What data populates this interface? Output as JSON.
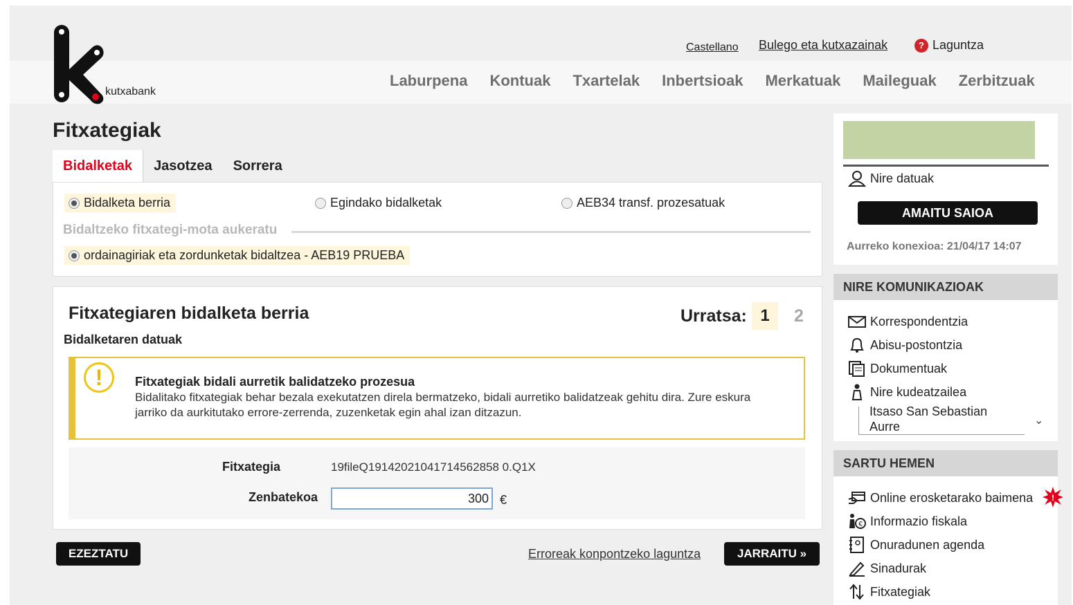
{
  "brand": {
    "name": "kutxabank"
  },
  "toplinks": {
    "language": "Castellano",
    "offices": "Bulego eta kutxazainak",
    "help": "Laguntza",
    "help_icon": "?"
  },
  "nav": {
    "items": [
      "Laburpena",
      "Kontuak",
      "Txartelak",
      "Inbertsioak",
      "Merkatuak",
      "Maileguak",
      "Zerbitzuak"
    ]
  },
  "page": {
    "title": "Fitxategiak"
  },
  "tabs": [
    "Bidalketak",
    "Jasotzea",
    "Sorrera"
  ],
  "options": {
    "radios": [
      "Bidalketa berria",
      "Egindako bidalketak",
      "AEB34 transf. prozesatuak"
    ],
    "legend": "Bidaltzeko fitxategi-mota aukeratu",
    "file_type": "ordainagiriak eta zordunketak bidaltzea - AEB19 PRUEBA"
  },
  "form": {
    "title": "Fitxategiaren bidalketa berria",
    "step_label": "Urratsa:",
    "step_current": "1",
    "step_next": "2",
    "subtitle": "Bidalketaren datuak",
    "alert_title": "Fitxategiak bidali aurretik balidatzeko prozesua",
    "alert_text": "Bidalitako fitxategiak behar bezala exekutatzen direla bermatzeko, bidali aurretiko balidatzeak gehitu dira. Zure eskura jarriko da aurkitutako errore-zerrenda, zuzenketak egin ahal izan ditzazun.",
    "file_label": "Fitxategia",
    "file_value": "19fileQ19142021041714562858 0.Q1X",
    "amount_label": "Zenbatekoa",
    "amount_value": "300",
    "currency": "€"
  },
  "actions": {
    "cancel": "EZEZTATU",
    "help_link": "Erroreak konpontzeko laguntza",
    "continue": "JARRAITU »"
  },
  "sidebar": {
    "my_data": "Nire datuak",
    "logout": "AMAITU SAIOA",
    "last_connection": "Aurreko konexioa: 21/04/17 14:07",
    "communications_title": "NIRE KOMUNIKAZIOAK",
    "communications": [
      "Korrespondentzia",
      "Abisu-postontzia",
      "Dokumentuak",
      "Nire kudeatzailea"
    ],
    "manager_name_1": "Itsaso San Sebastian",
    "manager_name_2": "Aurre",
    "enter_title": "SARTU HEMEN",
    "enter_items": [
      "Online erosketarako baimena",
      "Informazio fiskala",
      "Onuradunen agenda",
      "Sinadurak",
      "Fitxategiak"
    ]
  },
  "colors": {
    "accent": "#e3001b",
    "alert": "#e5c23a",
    "green_block": "#c3d3a4"
  }
}
